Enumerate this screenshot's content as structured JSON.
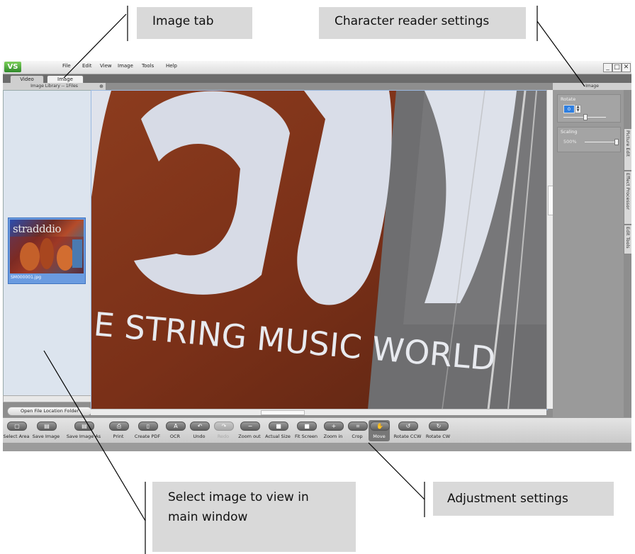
{
  "callouts": {
    "image_tab": "Image tab",
    "character_reader": "Character reader settings",
    "select_image": "Select image to view in main window",
    "adjustment": "Adjustment settings"
  },
  "app": {
    "logo": "VS",
    "menu": [
      "File",
      "Edit",
      "View",
      "Image",
      "Tools",
      "Help"
    ],
    "window_controls": [
      "_",
      "□",
      "✕"
    ],
    "tabs": [
      {
        "label": "Video",
        "active": false
      },
      {
        "label": "Image",
        "active": true
      }
    ]
  },
  "library": {
    "header": "Image Library -- 1Files",
    "thumbnail_text": "stradddio",
    "thumbnail_filename": "SM000001.jpg",
    "open_folder_button": "Open File Location Folder"
  },
  "image_view": {
    "content_text": "E STRING MUSIC WORLD"
  },
  "right_panel": {
    "header": "Image",
    "rotate_label": "Rotate",
    "rotate_value": "0",
    "scaling_label": "Scaling",
    "scaling_value": "500%",
    "side_tabs": [
      "Picture Edit",
      "Effect Processor",
      "Edit Tools"
    ]
  },
  "toolbar": {
    "tools": [
      {
        "label": "Select Area",
        "icon": "select-area-icon",
        "glyph": "▢"
      },
      {
        "label": "Save Image",
        "icon": "save-icon",
        "glyph": "▤"
      },
      {
        "label": "Save Image As",
        "icon": "save-as-icon",
        "glyph": "▤"
      },
      {
        "label": "Print",
        "icon": "print-icon",
        "glyph": "⎙"
      },
      {
        "label": "Create PDF",
        "icon": "pdf-icon",
        "glyph": "▯"
      },
      {
        "label": "OCR",
        "icon": "ocr-icon",
        "glyph": "A"
      },
      {
        "label": "Undo",
        "icon": "undo-icon",
        "glyph": "↶"
      },
      {
        "label": "Redo",
        "icon": "redo-icon",
        "glyph": "↷",
        "disabled": true
      },
      {
        "label": "Zoom out",
        "icon": "zoom-out-icon",
        "glyph": "−"
      },
      {
        "label": "Actual Size",
        "icon": "actual-size-icon",
        "glyph": "■"
      },
      {
        "label": "Fit Screen",
        "icon": "fit-screen-icon",
        "glyph": "■"
      },
      {
        "label": "Zoom in",
        "icon": "zoom-in-icon",
        "glyph": "+"
      },
      {
        "label": "Crop",
        "icon": "crop-icon",
        "glyph": "⌗"
      },
      {
        "label": "Move",
        "icon": "move-icon",
        "glyph": "✋",
        "active": true
      },
      {
        "label": "Rotate CCW",
        "icon": "rotate-ccw-icon",
        "glyph": "↺"
      },
      {
        "label": "Rotate CW",
        "icon": "rotate-cw-icon",
        "glyph": "↻"
      }
    ]
  }
}
